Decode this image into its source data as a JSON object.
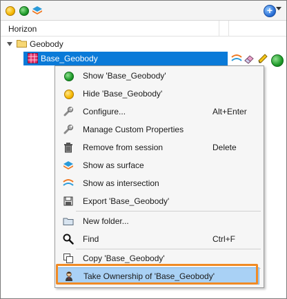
{
  "toolbar": {
    "icons": [
      "status-yellow-icon",
      "status-green-icon",
      "surface-layers-icon",
      "add-icon"
    ],
    "add_glyph": "+"
  },
  "tree": {
    "column_header": "Horizon",
    "folder_label": "Geobody",
    "selected_item": "Base_Geobody",
    "row_icons": [
      "intersection-icon",
      "eraser-icon",
      "pencil-icon",
      "status-green-icon"
    ]
  },
  "context_menu": {
    "items": [
      {
        "label": "Show 'Base_Geobody'",
        "shortcut": "",
        "icon": "green-dot-icon"
      },
      {
        "label": "Hide 'Base_Geobody'",
        "shortcut": "",
        "icon": "yellow-dot-icon"
      },
      {
        "label": "Configure...",
        "shortcut": "Alt+Enter",
        "icon": "wrench-icon"
      },
      {
        "label": "Manage Custom Properties",
        "shortcut": "",
        "icon": "wrench-icon"
      },
      {
        "label": "Remove from session",
        "shortcut": "Delete",
        "icon": "trash-icon"
      },
      {
        "label": "Show as surface",
        "shortcut": "",
        "icon": "surface-icon"
      },
      {
        "label": "Show as intersection",
        "shortcut": "",
        "icon": "intersection-icon"
      },
      {
        "label": "Export 'Base_Geobody'",
        "shortcut": "",
        "icon": "export-icon"
      },
      {
        "label": "New folder...",
        "shortcut": "",
        "icon": "folder-icon"
      },
      {
        "label": "Find",
        "shortcut": "Ctrl+F",
        "icon": "magnifier-icon"
      },
      {
        "label": "Copy 'Base_Geobody'",
        "shortcut": "",
        "icon": "copy-icon"
      },
      {
        "label": "Take Ownership of 'Base_Geobody'",
        "shortcut": "",
        "icon": "user-icon"
      }
    ],
    "highlighted_item": "Take Ownership of 'Base_Geobody'"
  },
  "colors": {
    "selection": "#0a7ad8",
    "menu_highlight": "#a9d1f5",
    "callout_orange": "#f08a24"
  }
}
